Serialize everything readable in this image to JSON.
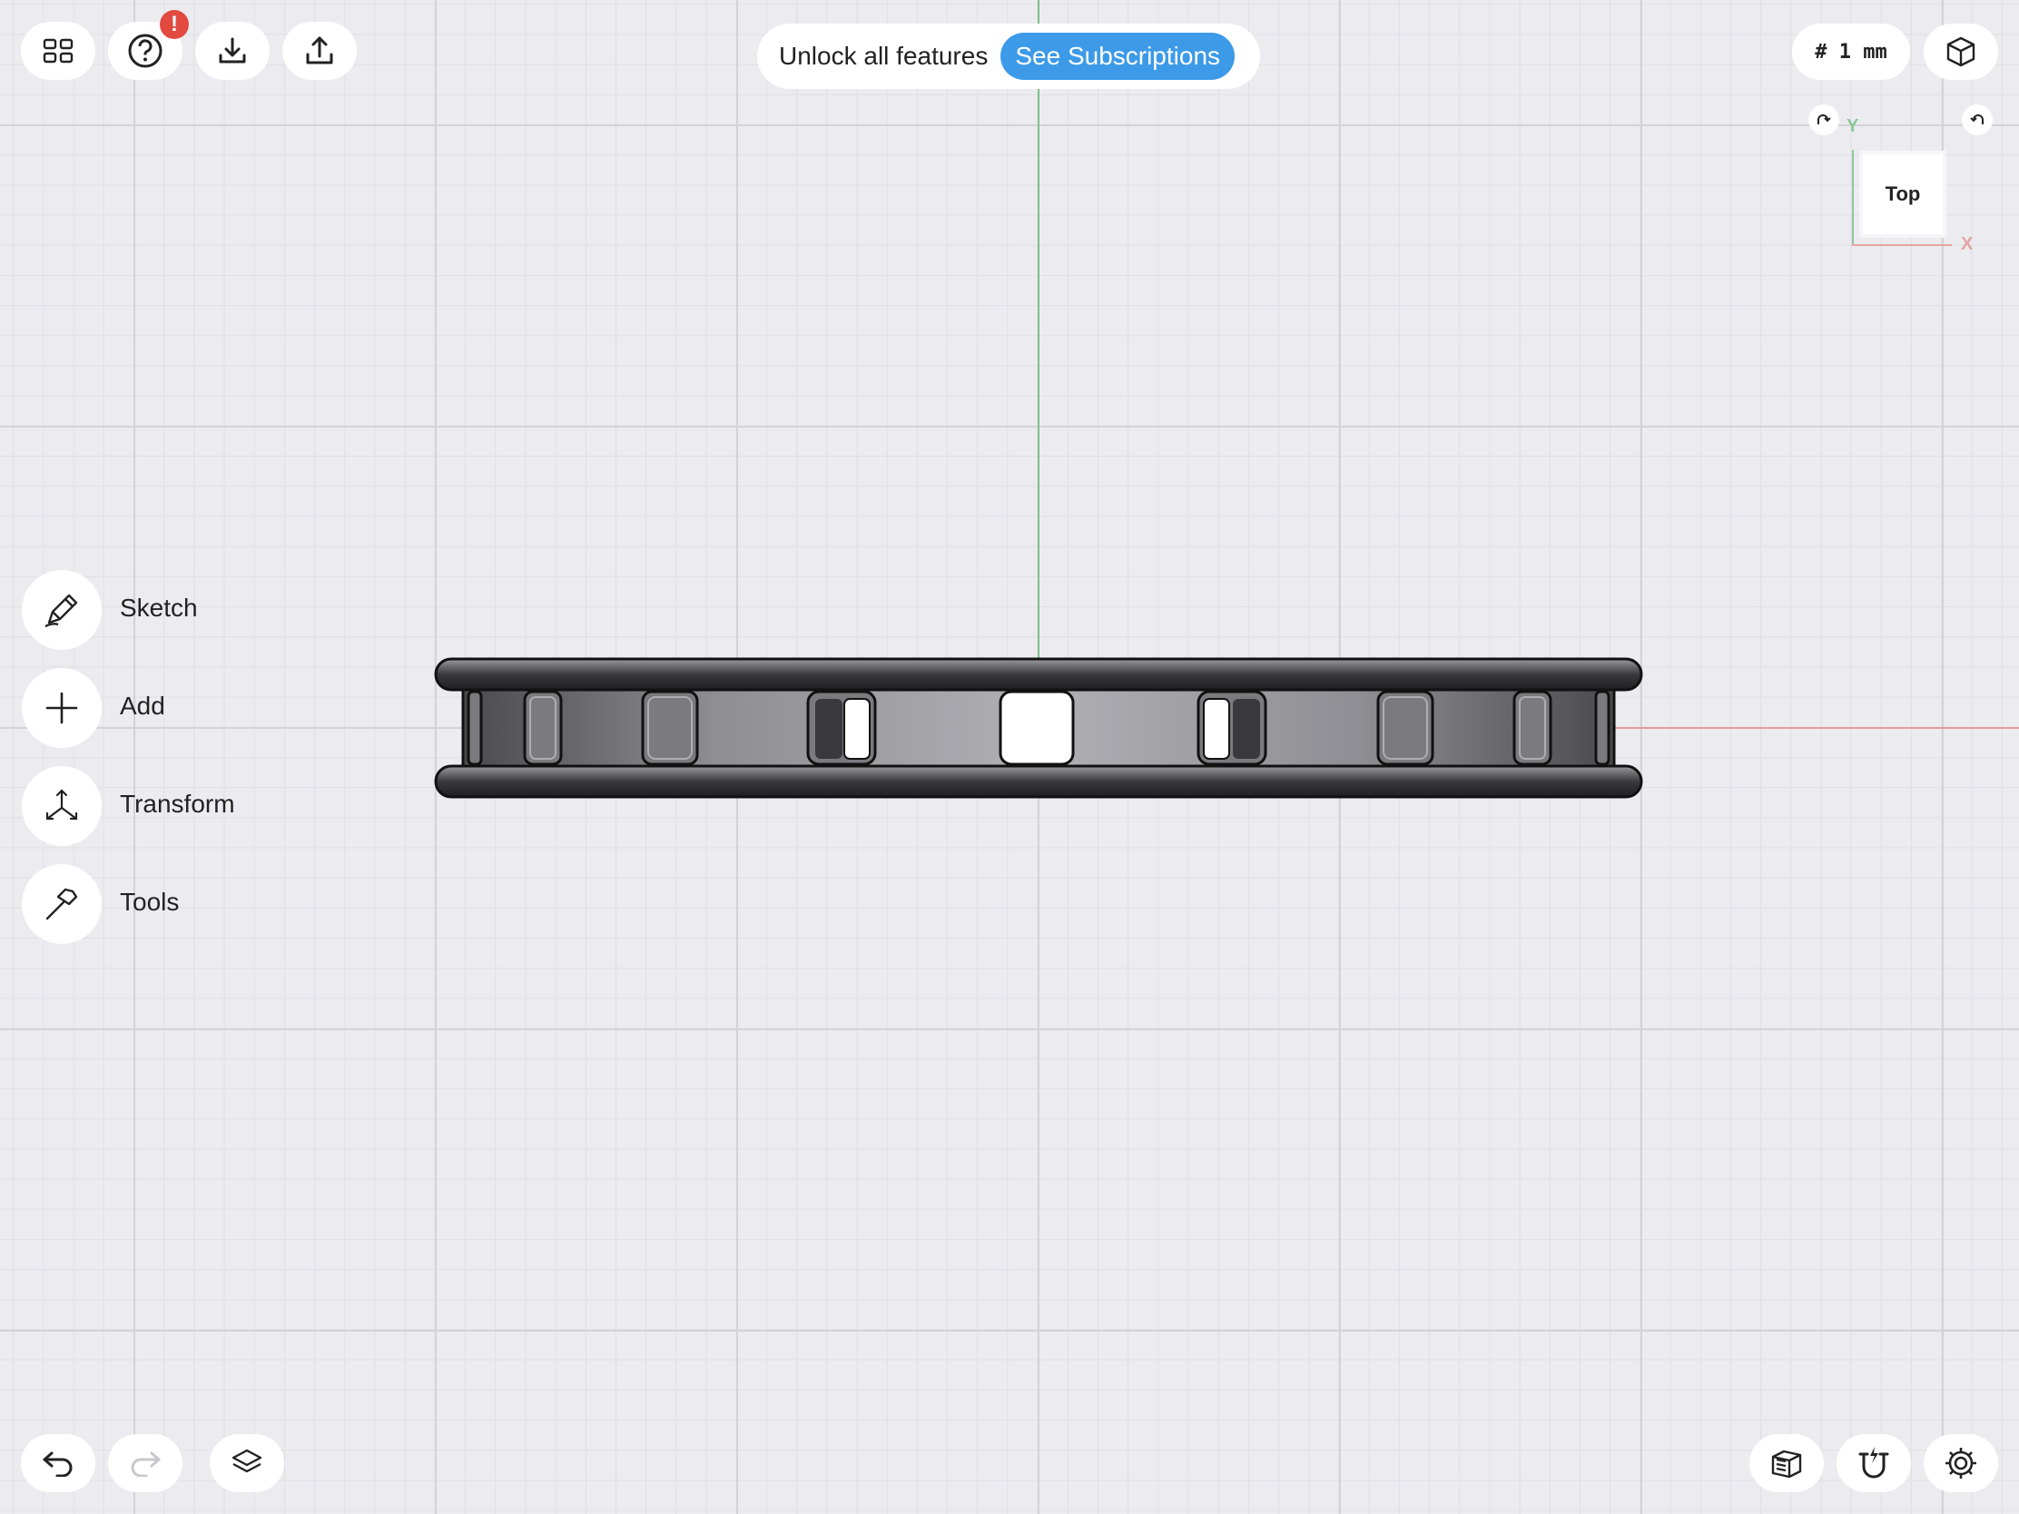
{
  "app": {
    "accent": "#3c9ae8",
    "badge_color": "#e24a3f",
    "grid_color": "#d2d2d7"
  },
  "top_toolbar": {
    "buttons": [
      {
        "icon": "grid-icon"
      },
      {
        "icon": "help-icon",
        "badge": "!"
      },
      {
        "icon": "download-icon"
      },
      {
        "icon": "share-icon"
      }
    ]
  },
  "banner": {
    "text": "Unlock all features",
    "button": "See Subscriptions"
  },
  "grid_size": {
    "label": "# 1 mm"
  },
  "view_cube": {
    "face": "Top",
    "axis_y": "Y",
    "axis_x": "X"
  },
  "tools": [
    {
      "label": "Sketch",
      "icon": "pencil-icon"
    },
    {
      "label": "Add",
      "icon": "plus-icon"
    },
    {
      "label": "Transform",
      "icon": "transform-icon"
    },
    {
      "label": "Tools",
      "icon": "hammer-icon"
    }
  ],
  "bottom_toolbar": {
    "left": [
      {
        "icon": "undo-icon"
      },
      {
        "icon": "redo-icon"
      },
      {
        "icon": "layers-icon"
      }
    ],
    "right": [
      {
        "icon": "section-view-icon"
      },
      {
        "icon": "snap-magnet-icon"
      },
      {
        "icon": "settings-gear-icon"
      }
    ]
  }
}
